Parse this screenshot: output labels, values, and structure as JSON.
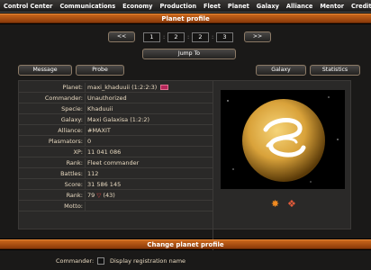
{
  "nav": [
    "Control Center",
    "Communications",
    "Economy",
    "Production",
    "Fleet",
    "Planet",
    "Galaxy",
    "Alliance",
    "Mentor",
    "Credits"
  ],
  "header": {
    "title": "Planet profile"
  },
  "coords": {
    "prev": "<<",
    "next": ">>",
    "galaxy": "1",
    "system": "2",
    "orbit": "2",
    "position": "3",
    "jump": "Jump To"
  },
  "actions": {
    "message": "Message",
    "probe": "Probe",
    "galaxy": "Galaxy",
    "statistics": "Statistics"
  },
  "profile": {
    "planet": {
      "label": "Planet:",
      "value": "maxi_khaduuii (1:2:2:3)"
    },
    "commander": {
      "label": "Commander:",
      "value": "Unauthorized"
    },
    "specie": {
      "label": "Specie:",
      "value": "Khaduuii"
    },
    "galaxy": {
      "label": "Galaxy:",
      "value": "Maxi Galaxisa (1:2:2)"
    },
    "alliance": {
      "label": "Alliance:",
      "value": "#MAXIT"
    },
    "plasmators": {
      "label": "Plasmators:",
      "value": "0"
    },
    "xp": {
      "label": "XP:",
      "value": "11 041 086"
    },
    "rank_title": {
      "label": "Rank:",
      "value": "Fleet commander"
    },
    "battles": {
      "label": "Battles:",
      "value": "112"
    },
    "score": {
      "label": "Score:",
      "value": "31 586 145"
    },
    "rank": {
      "label": "Rank:",
      "value": "79",
      "change": "(43)"
    },
    "motto": {
      "label": "Motto:",
      "value": ""
    }
  },
  "footer": {
    "title": "Change planet profile",
    "commander_label": "Commander:",
    "checkbox_label": "Display registration name"
  },
  "colors": {
    "accent": "#c9661a",
    "planet": "#d9a23a",
    "rank_arrow": "#d24040"
  }
}
